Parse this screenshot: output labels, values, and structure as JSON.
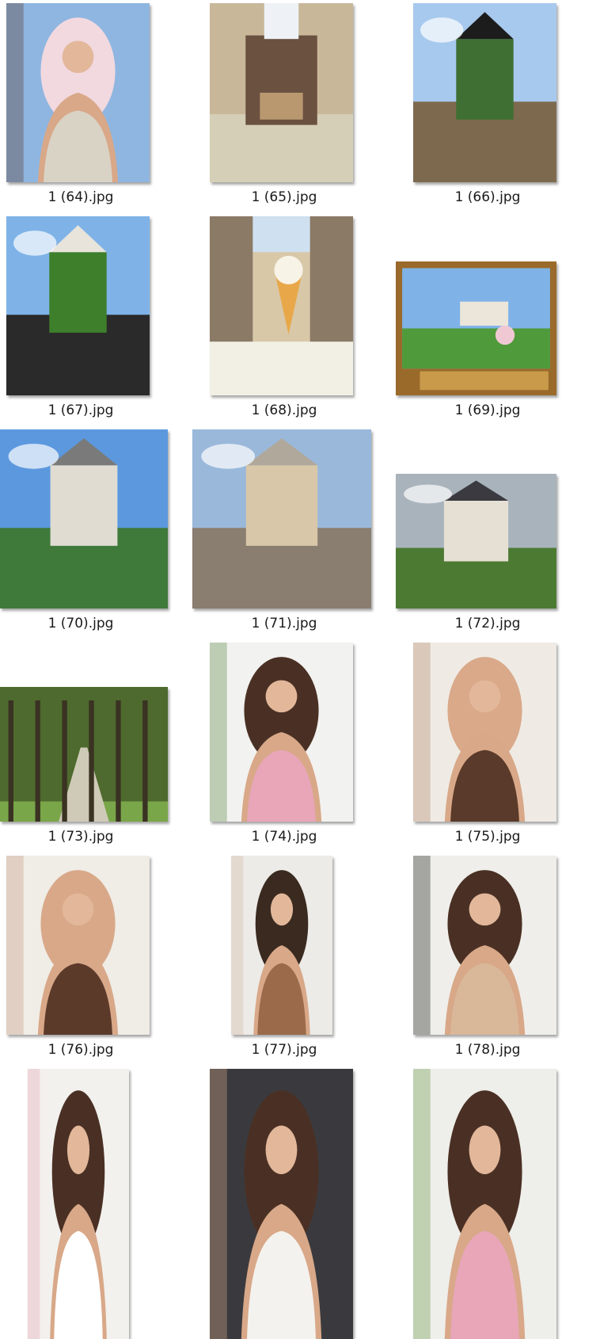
{
  "files": [
    {
      "name": "1 (64).jpg",
      "scene": "selfie-castle",
      "colors": [
        "#8fb6e0",
        "#d9d3c6",
        "#f2d9e0",
        "#5a3a2a"
      ]
    },
    {
      "name": "1 (65).jpg",
      "scene": "interior-screen",
      "colors": [
        "#c9b79a",
        "#6a5140",
        "#d6cfb8",
        "#b99870"
      ]
    },
    {
      "name": "1 (66).jpg",
      "scene": "river-garden",
      "colors": [
        "#a8c9ee",
        "#3f6f33",
        "#7d6a4e",
        "#1c1c1c"
      ]
    },
    {
      "name": "1 (67).jpg",
      "scene": "sculpture-garden",
      "colors": [
        "#7fb3e8",
        "#3e7f2b",
        "#2a2a2a",
        "#e8e4dc"
      ]
    },
    {
      "name": "1 (68).jpg",
      "scene": "street-icecream",
      "colors": [
        "#d8c8a8",
        "#8a7a66",
        "#e8a84a",
        "#f2efe4"
      ]
    },
    {
      "name": "1 (69).jpg",
      "scene": "framed-chateau",
      "colors": [
        "#9a6a2a",
        "#7fb3e8",
        "#4f9a3a",
        "#f0c8d4"
      ]
    },
    {
      "name": "1 (70).jpg",
      "scene": "tower-garden",
      "colors": [
        "#5c98de",
        "#e0dcd2",
        "#3f7a3a",
        "#7a7a7a"
      ]
    },
    {
      "name": "1 (71).jpg",
      "scene": "town-square",
      "colors": [
        "#9ab8da",
        "#d8c7a8",
        "#8a7e70",
        "#b0a89a"
      ]
    },
    {
      "name": "1 (72).jpg",
      "scene": "chateau-field",
      "colors": [
        "#a9b3bc",
        "#e6e0d4",
        "#4c7a32",
        "#3a3a40"
      ]
    },
    {
      "name": "1 (73).jpg",
      "scene": "tree-alley",
      "colors": [
        "#7aa64a",
        "#4e6a2e",
        "#cfcab8",
        "#3a3222"
      ]
    },
    {
      "name": "1 (74).jpg",
      "scene": "pink-dress",
      "colors": [
        "#f2f2f0",
        "#e8a6b8",
        "#4a3024",
        "#5c8a46"
      ]
    },
    {
      "name": "1 (75).jpg",
      "scene": "brown-bikini-bath",
      "colors": [
        "#efebe4",
        "#5a3a2a",
        "#d9a98a",
        "#b48a70"
      ]
    },
    {
      "name": "1 (76).jpg",
      "scene": "bikini-room",
      "colors": [
        "#f0ece6",
        "#5c3a2a",
        "#d8a888",
        "#c49a7e"
      ]
    },
    {
      "name": "1 (77).jpg",
      "scene": "leopard-dress",
      "colors": [
        "#ecebe8",
        "#9a6a4a",
        "#3a2a20",
        "#d8b8a0"
      ]
    },
    {
      "name": "1 (78).jpg",
      "scene": "beige-dress",
      "colors": [
        "#efeeea",
        "#d9b89a",
        "#4a3024",
        "#1c1c1c"
      ]
    },
    {
      "name": "",
      "scene": "white-tee",
      "colors": [
        "#f2f1ee",
        "#ffffff",
        "#4a3024",
        "#e8a6b8"
      ]
    },
    {
      "name": "",
      "scene": "white-top-dark",
      "colors": [
        "#3a3a3e",
        "#f4f2ee",
        "#4a3024",
        "#d8a888"
      ]
    },
    {
      "name": "",
      "scene": "pink-coffee",
      "colors": [
        "#eeeeea",
        "#e8a6b8",
        "#4a3024",
        "#6a9a4a"
      ]
    }
  ]
}
